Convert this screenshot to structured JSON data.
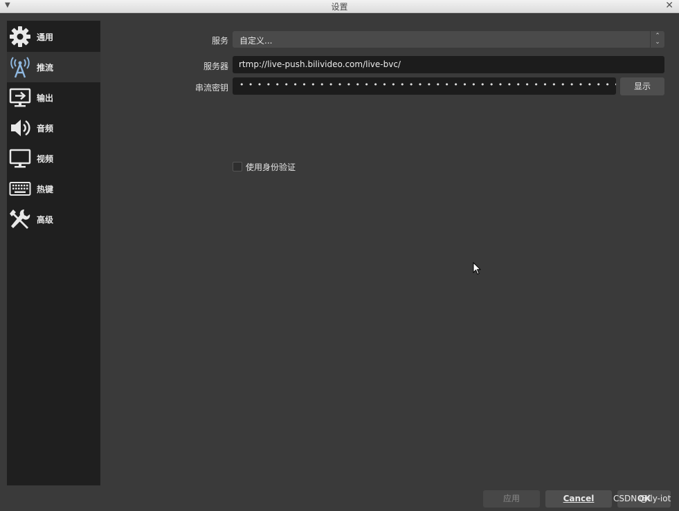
{
  "window": {
    "title": "设置",
    "close_glyph": "✕",
    "menu_glyph": "▼"
  },
  "sidebar": {
    "items": [
      {
        "label": "通用",
        "icon": "gear-icon"
      },
      {
        "label": "推流",
        "icon": "antenna-icon"
      },
      {
        "label": "输出",
        "icon": "monitor-output-icon"
      },
      {
        "label": "音频",
        "icon": "speaker-icon"
      },
      {
        "label": "视频",
        "icon": "monitor-icon"
      },
      {
        "label": "热键",
        "icon": "keyboard-icon"
      },
      {
        "label": "高级",
        "icon": "tools-icon"
      }
    ],
    "active_index": 1
  },
  "stream": {
    "service_label": "服务",
    "service_value": "自定义...",
    "server_label": "服务器",
    "server_value": "rtmp://live-push.bilivideo.com/live-bvc/",
    "key_label": "串流密钥",
    "key_mask": "•••••••••••••••••••••••••••••••••••••••••••••••••••••",
    "show_button": "显示",
    "auth_checkbox_label": "使用身份验证",
    "auth_checked": false
  },
  "footer": {
    "apply_label": "应用",
    "cancel_label": "Cancel",
    "ok_label": "OK",
    "watermark": "CSDN @lly-iot"
  },
  "colors": {
    "background": "#3a3a3a",
    "sidebar": "#1f1f1f",
    "active_item": "#333333",
    "input": "#1c1c1c"
  }
}
